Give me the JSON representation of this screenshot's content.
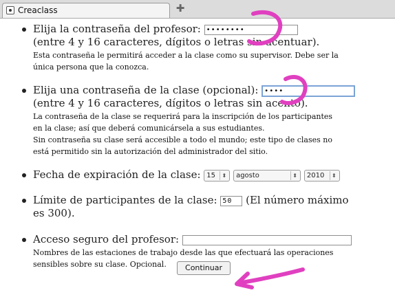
{
  "tabs": {
    "active_title": "Creaclass",
    "new_tab_glyph": "✚"
  },
  "form": {
    "teacher_password": {
      "label": "Elija la contraseña del profesor:",
      "value": "••••••••",
      "hint": "(entre 4 y 16 caracteres, dígitos o letras sin acentuar).",
      "note1": "Esta contraseña le permitirá acceder a la clase como su supervisor. Debe ser la",
      "note2": "única persona que la conozca."
    },
    "class_password": {
      "label": "Elija una contraseña de la clase (opcional):",
      "value": "••••",
      "hint": "(entre 4 y 16 caracteres, dígitos o letras sin acento).",
      "note1": "La contraseña de la clase se requerirá para la inscripción de los participantes",
      "note2": "en la clase; así que deberá comunicársela a sus estudiantes.",
      "note3": "Sin contraseña su clase será accesible a todo el mundo; este tipo de clases no",
      "note4": "está permitido sin la autorización del administrador del sitio."
    },
    "expiration": {
      "label": "Fecha de expiración de la clase:",
      "day": "15",
      "month": "agosto",
      "year": "2010",
      "spinner_glyph": "⬍"
    },
    "participants": {
      "label": "Límite de participantes de la clase:",
      "value": "50",
      "suffix": "(El número máximo",
      "suffix2": "es 300)."
    },
    "secure_access": {
      "label": "Acceso seguro del profesor:",
      "value": "",
      "note1": "Nombres de las estaciones de trabajo desde las que efectuará las operaciones",
      "note2": "sensibles sobre su clase. Opcional."
    },
    "continue_label": "Continuar"
  },
  "colors": {
    "annotation": "#e040c0",
    "focus_border": "#7aa3d6"
  }
}
